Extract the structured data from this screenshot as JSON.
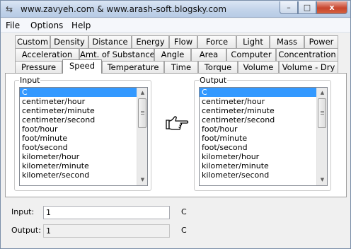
{
  "window": {
    "title": "www.zavyeh.com & www.arash-soft.blogsky.com",
    "minimize_glyph": "–",
    "maximize_glyph": "□",
    "close_glyph": "x"
  },
  "menu": {
    "items": [
      "File",
      "Options",
      "Help"
    ]
  },
  "tabs": {
    "row1": [
      "Custom",
      "Density",
      "Distance",
      "Energy",
      "Flow",
      "Force",
      "Light",
      "Mass",
      "Power"
    ],
    "row2": [
      "Acceleration",
      "Amt. of Substance",
      "Angle",
      "Area",
      "Computer",
      "Concentration"
    ],
    "row3": [
      "Pressure",
      "Speed",
      "Temperature",
      "Time",
      "Torque",
      "Volume",
      "Volume - Dry"
    ],
    "active": "Speed"
  },
  "input_group": {
    "label": "Input",
    "items": [
      "C",
      "centimeter/hour",
      "centimeter/minute",
      "centimeter/second",
      "foot/hour",
      "foot/minute",
      "foot/second",
      "kilometer/hour",
      "kilometer/minute",
      "kilometer/second"
    ],
    "selected_index": 0
  },
  "output_group": {
    "label": "Output",
    "items": [
      "C",
      "centimeter/hour",
      "centimeter/minute",
      "centimeter/second",
      "foot/hour",
      "foot/minute",
      "foot/second",
      "kilometer/hour",
      "kilometer/minute",
      "kilometer/second"
    ],
    "selected_index": 0
  },
  "convert_icon": "pointing-hand-icon",
  "input_field": {
    "label": "Input:",
    "value": "1",
    "unit": "C"
  },
  "output_field": {
    "label": "Output:",
    "value": "1",
    "unit": "C"
  },
  "colors": {
    "selection": "#3399ff",
    "titlebar": "#c3d4ea"
  }
}
